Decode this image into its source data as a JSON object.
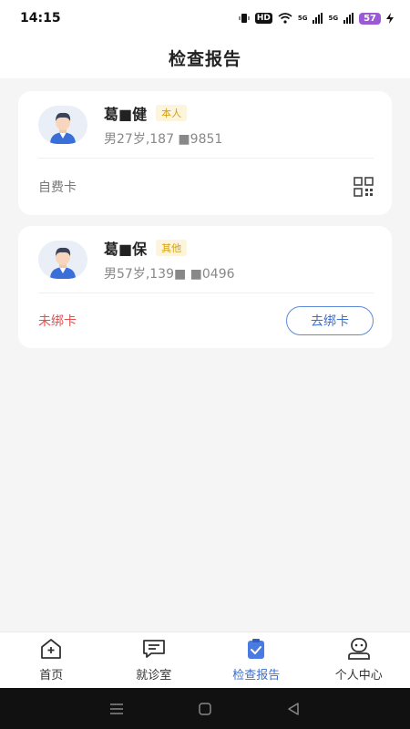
{
  "status_bar": {
    "time": "14:15",
    "hd": "HD",
    "network1": "5G",
    "network2": "5G",
    "battery": "57"
  },
  "header": {
    "title": "检查报告"
  },
  "patients": [
    {
      "name": "葛■健",
      "tag": "本人",
      "detail": "男27岁,187 ■9851",
      "card_type": "自费卡"
    },
    {
      "name": "葛■保",
      "tag": "其他",
      "detail": "男57岁,139■ ■0496",
      "card_type": "未绑卡",
      "bind_label": "去绑卡"
    }
  ],
  "tabbar": {
    "items": [
      {
        "label": "首页",
        "icon": "home-plus-icon",
        "active": false
      },
      {
        "label": "就诊室",
        "icon": "chat-icon",
        "active": false
      },
      {
        "label": "检查报告",
        "icon": "report-clipboard-icon",
        "active": true
      },
      {
        "label": "个人中心",
        "icon": "user-profile-icon",
        "active": false
      }
    ]
  },
  "colors": {
    "accent": "#3b6fd0",
    "unbound": "#e05050",
    "tag_text": "#d4a017",
    "tag_bg": "#fdf4dc"
  }
}
